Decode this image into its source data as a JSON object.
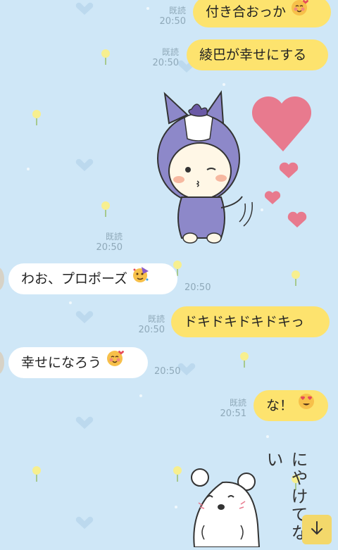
{
  "messages": [
    {
      "side": "right",
      "text": "付き合おっか",
      "emoji": "smiling-hearts",
      "read": "既読",
      "time": "20:50"
    },
    {
      "side": "right",
      "text": "綾巴が幸せにする",
      "read": "既読",
      "time": "20:50"
    },
    {
      "side": "right",
      "type": "sticker",
      "sticker": "purple-horse-hood-character-kiss",
      "read": "既読",
      "time": "20:50"
    },
    {
      "side": "left",
      "text": "わお、プロポーズ",
      "emoji": "party-face",
      "time": "20:50"
    },
    {
      "side": "right",
      "text": "ドキドキドキドキっ",
      "read": "既読",
      "time": "20:50"
    },
    {
      "side": "left",
      "text": "幸せになろう",
      "emoji": "smiling-hearts",
      "time": "20:50"
    },
    {
      "side": "right",
      "text": "な！",
      "emoji": "heart-eyes",
      "read": "既読",
      "time": "20:51"
    },
    {
      "side": "right",
      "type": "sticker",
      "sticker": "white-bear",
      "caption": "にやけてない"
    }
  ],
  "scroll_button": {
    "icon": "arrow-down-icon"
  },
  "colors": {
    "background": "#cfe7f7",
    "my_bubble": "#fde36e",
    "their_bubble": "#ffffff",
    "meta": "#8fa9b9"
  }
}
